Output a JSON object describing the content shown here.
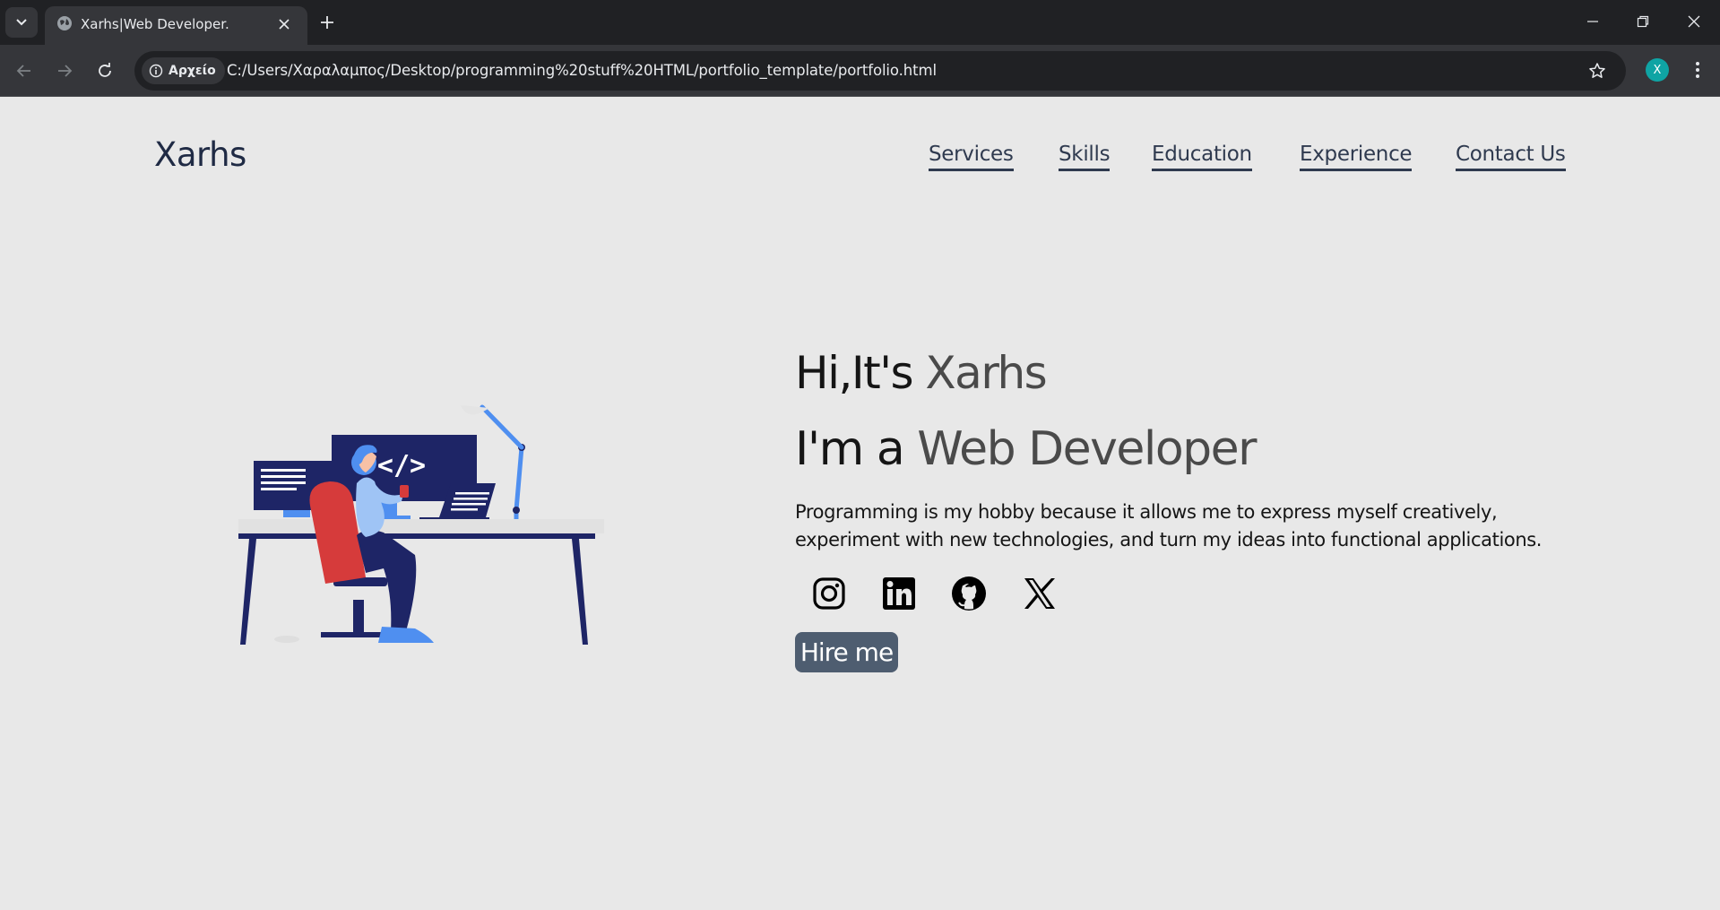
{
  "browser": {
    "tab_title": "Xarhs|Web Developer.",
    "site_chip_label": "Αρχείο",
    "url": "C:/Users/Χαραλαμπος/Desktop/programming%20stuff%20HTML/portfolio_template/portfolio.html",
    "profile_initial": "X",
    "profile_color": "#0fa4a4"
  },
  "header": {
    "logo": "Xarhs",
    "nav": [
      {
        "label": "Services"
      },
      {
        "label": "Skills"
      },
      {
        "label": "Education"
      },
      {
        "label": "Experience"
      },
      {
        "label": "Contact Us"
      }
    ]
  },
  "hero": {
    "greeting_prefix": "Hi,It's ",
    "name": "Xarhs",
    "role_prefix": "I'm a ",
    "role": "Web Developer",
    "description": "Programming is my hobby because it allows me to express myself creatively, experiment with new technologies, and turn my ideas into functional applications.",
    "socials": [
      {
        "icon": "instagram-icon"
      },
      {
        "icon": "linkedin-icon"
      },
      {
        "icon": "github-icon"
      },
      {
        "icon": "x-icon"
      }
    ],
    "hire_label": "Hire me",
    "hire_color": "#4e5d70"
  },
  "colors": {
    "page_bg": "#e8e8e8",
    "text": "#151515",
    "accent_text": "#4a4a4a",
    "illustration_navy": "#1e2566",
    "illustration_blue": "#4f8ff0",
    "illustration_red": "#d63b3b"
  }
}
